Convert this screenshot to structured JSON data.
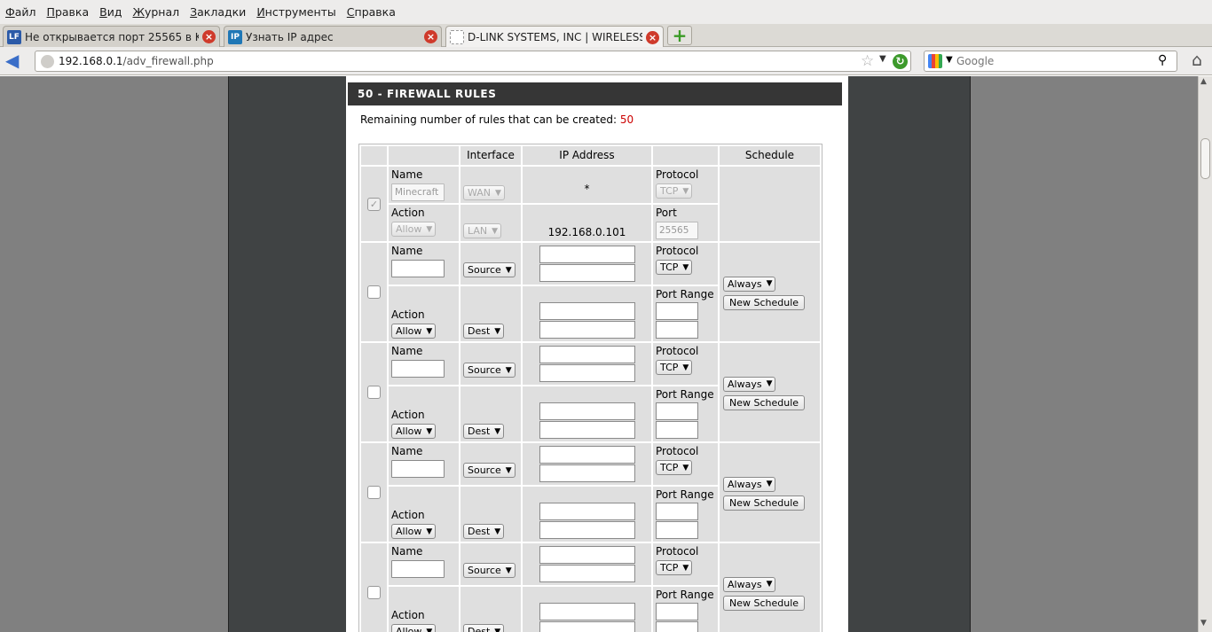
{
  "menu": [
    "Файл",
    "Правка",
    "Вид",
    "Журнал",
    "Закладки",
    "Инструменты",
    "Справка"
  ],
  "menu_access": [
    "Ф",
    "П",
    "В",
    "Ж",
    "З",
    "И",
    "С"
  ],
  "tabs": [
    {
      "favicon": "LF",
      "title": "Не открывается порт 25565 в Ku...",
      "favcolor": "#2b5aa8"
    },
    {
      "favicon": "IP",
      "title": "Узнать IP адрес",
      "favcolor": "#1f77b6"
    },
    {
      "favicon": "",
      "title": "D-LINK SYSTEMS, INC | WIRELESS ...",
      "favcolor": "#ffffff"
    }
  ],
  "newtab_label": "+",
  "url": {
    "host": "192.168.0.1",
    "path": "/adv_firewall.php"
  },
  "search": {
    "placeholder": "Google"
  },
  "page": {
    "section_title": "50 - FIREWALL RULES",
    "remaining_label": "Remaining number of rules that can be created:",
    "remaining_count": "50",
    "headers": {
      "interface": "Interface",
      "ip": "IP Address",
      "schedule": "Schedule"
    },
    "labels": {
      "name": "Name",
      "action": "Action",
      "protocol": "Protocol",
      "port": "Port",
      "port_range": "Port Range"
    },
    "first_rule": {
      "name": "Minecraft",
      "iface_top": "WAN",
      "iface_bottom": "LAN",
      "ip_top": "*",
      "ip_bottom": "192.168.0.101",
      "action": "Allow",
      "protocol": "TCP",
      "port": "25565"
    },
    "rule_defaults": {
      "source": "Source",
      "dest": "Dest",
      "action": "Allow",
      "protocol": "TCP",
      "schedule": "Always",
      "new_schedule": "New Schedule"
    }
  }
}
